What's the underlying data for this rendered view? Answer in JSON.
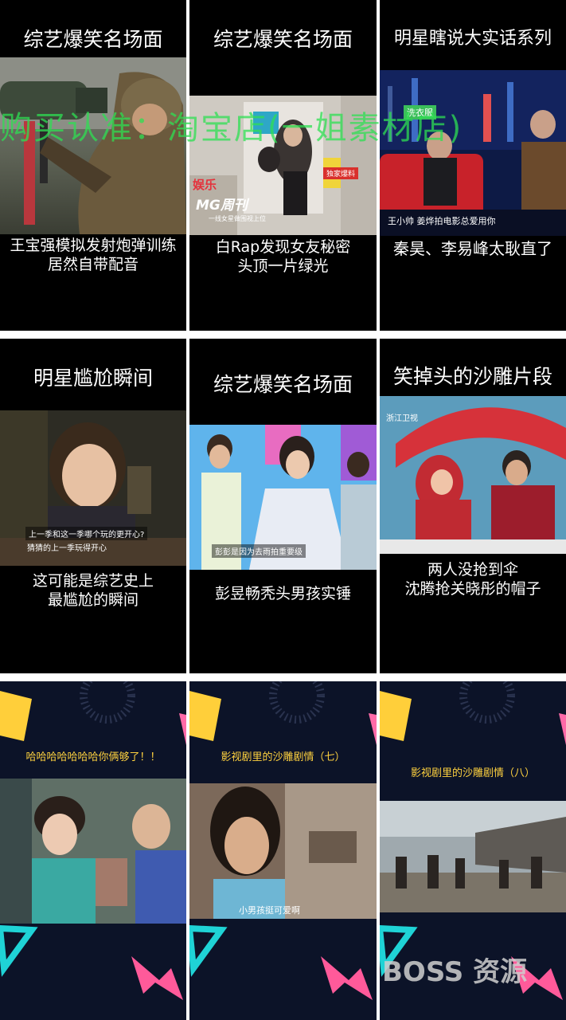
{
  "grid": {
    "cells": [
      {
        "title": "综艺爆笑名场面",
        "caption": [
          "王宝强模拟发射炮弹训练",
          "居然自带配音"
        ]
      },
      {
        "title": "综艺爆笑名场面",
        "caption": [
          "白Rap发现女友秘密",
          "头顶一片绿光"
        ],
        "overlays": {
          "mag_brand": "MG周刊",
          "mag_badge": "独家爆料",
          "mag_sub": "一线女星做围视上位",
          "mag_red": "娱乐"
        }
      },
      {
        "title": "明星瞎说大实话系列",
        "caption": [
          "秦昊、李易峰太耿直了"
        ],
        "overlays": {
          "show_tag": "洗衣服",
          "subtitle": "王小帅 姜烨拍电影总爱用你"
        }
      },
      {
        "title": "明星尴尬瞬间",
        "caption": [
          "这可能是综艺史上",
          "最尴尬的瞬间"
        ],
        "overlays": {
          "sub1": "上一季和这一季哪个玩的更开心?",
          "sub2": "猜猜的上一季玩得开心"
        }
      },
      {
        "title": "综艺爆笑名场面",
        "caption": [
          "彭昱畅秃头男孩实锤"
        ],
        "overlays": {
          "sub": "彭彭是因为去雨拍重要级"
        }
      },
      {
        "title": "笑掉头的沙雕片段",
        "caption": [
          "两人没抢到伞",
          "沈腾抢关晓彤的帽子"
        ],
        "overlays": {
          "channel": "浙江卫视"
        }
      },
      {
        "subtitle": "哈哈哈哈哈哈哈你俩够了！！"
      },
      {
        "subtitle": "影视剧里的沙雕剧情（七）",
        "overlays": {
          "sub": "小男孩挺可爱啊"
        }
      },
      {
        "subtitle": "影视剧里的沙雕剧情（八）"
      }
    ]
  },
  "watermarks": {
    "top": "购买认准：淘宝店(一姐素材店)",
    "bottom": "BOSS 资源"
  },
  "colors": {
    "background": "#000000",
    "divider": "#ffffff",
    "watermark_green": "#2ee052",
    "dark_card": "#0c1328",
    "yellow": "#ffd23f",
    "cyan": "#1fd3d6",
    "pink": "#ff5fa3"
  }
}
